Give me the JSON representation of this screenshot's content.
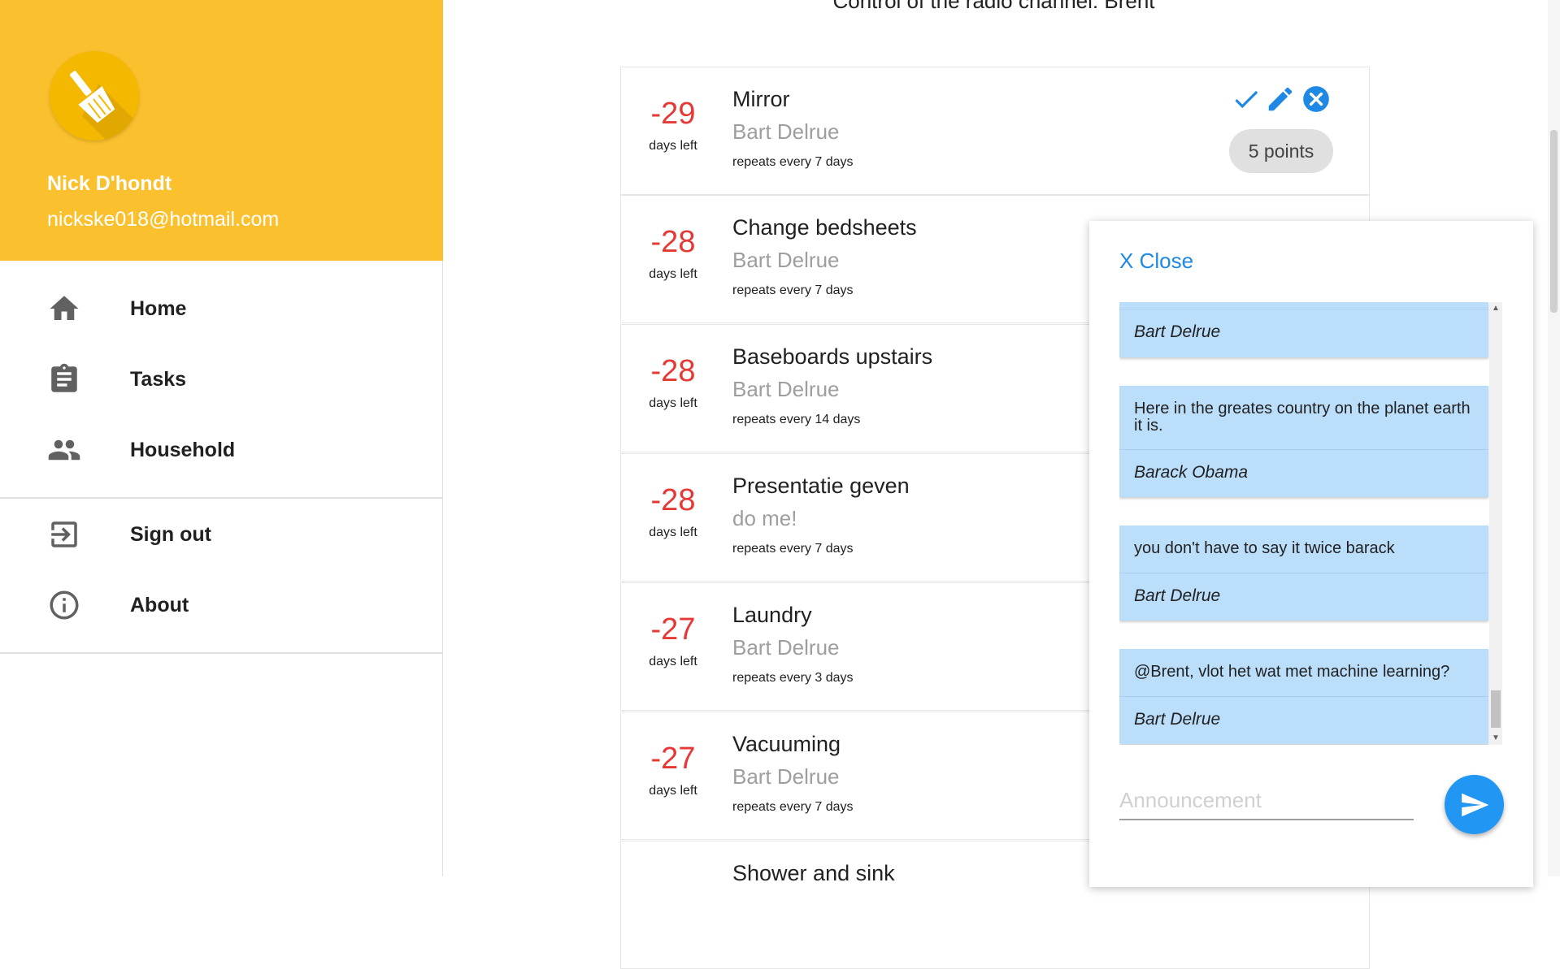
{
  "page": {
    "heading": "Control of the radio channel: Brent"
  },
  "sidebar": {
    "user": {
      "name": "Nick D'hondt",
      "email": "nickske018@hotmail.com"
    },
    "nav": [
      {
        "label": "Home",
        "icon": "home-icon"
      },
      {
        "label": "Tasks",
        "icon": "clipboard-icon"
      },
      {
        "label": "Household",
        "icon": "people-icon"
      },
      {
        "label": "Sign out",
        "icon": "sign-out-icon"
      },
      {
        "label": "About",
        "icon": "info-icon"
      }
    ]
  },
  "tasks": [
    {
      "days": "-29",
      "days_label": "days left",
      "name": "Mirror",
      "assignee": "Bart Delrue",
      "repeat": "repeats every 7 days",
      "points": "5 points"
    },
    {
      "days": "-28",
      "days_label": "days left",
      "name": "Change bedsheets",
      "assignee": "Bart Delrue",
      "repeat": "repeats every 7 days"
    },
    {
      "days": "-28",
      "days_label": "days left",
      "name": "Baseboards upstairs",
      "assignee": "Bart Delrue",
      "repeat": "repeats every 14 days"
    },
    {
      "days": "-28",
      "days_label": "days left",
      "name": "Presentatie geven",
      "assignee": "do me!",
      "repeat": "repeats every 7 days"
    },
    {
      "days": "-27",
      "days_label": "days left",
      "name": "Laundry",
      "assignee": "Bart Delrue",
      "repeat": "repeats every 3 days"
    },
    {
      "days": "-27",
      "days_label": "days left",
      "name": "Vacuuming",
      "assignee": "Bart Delrue",
      "repeat": "repeats every 7 days"
    },
    {
      "name": "Shower and sink"
    }
  ],
  "chat": {
    "close_label": "X Close",
    "messages": [
      {
        "author": "Bart Delrue"
      },
      {
        "text": "Here in the greates country on the planet earth it is.",
        "author": "Barack Obama"
      },
      {
        "text": "you don't have to say it twice barack",
        "author": "Bart Delrue"
      },
      {
        "text": "@Brent, vlot het wat met machine learning?",
        "author": "Bart Delrue"
      }
    ],
    "input_placeholder": "Announcement",
    "input_value": ""
  },
  "colors": {
    "header": "#FBC02D",
    "days_overdue": "#e53935",
    "accent": "#1e88e5",
    "message_bg": "#BBDEFB"
  }
}
